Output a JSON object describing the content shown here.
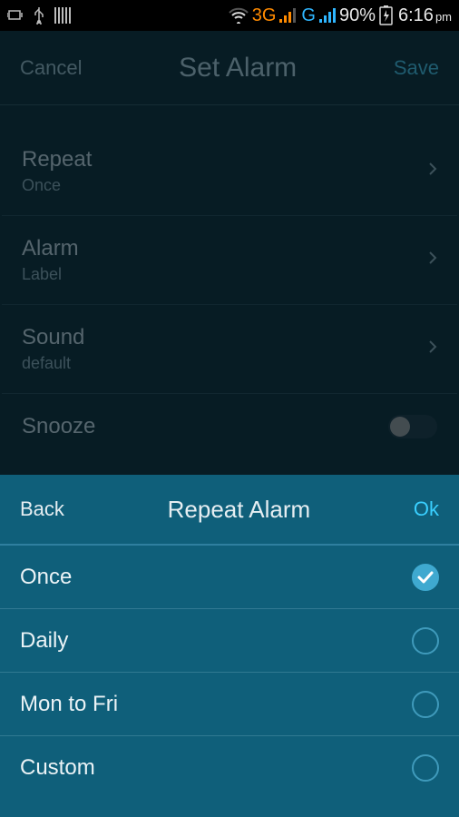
{
  "status": {
    "battery_pct": "90%",
    "time": "6:16",
    "time_suffix": "pm",
    "net1": "3G",
    "net2": "G"
  },
  "header": {
    "cancel": "Cancel",
    "title": "Set Alarm",
    "save": "Save"
  },
  "settings": {
    "repeat": {
      "label": "Repeat",
      "value": "Once"
    },
    "alarm": {
      "label": "Alarm",
      "value": "Label"
    },
    "sound": {
      "label": "Sound",
      "value": "default"
    },
    "snooze": {
      "label": "Snooze",
      "enabled": false
    }
  },
  "sheet": {
    "back": "Back",
    "title": "Repeat Alarm",
    "ok": "Ok",
    "options": [
      {
        "label": "Once",
        "selected": true
      },
      {
        "label": "Daily",
        "selected": false
      },
      {
        "label": "Mon to Fri",
        "selected": false
      },
      {
        "label": "Custom",
        "selected": false
      }
    ]
  }
}
